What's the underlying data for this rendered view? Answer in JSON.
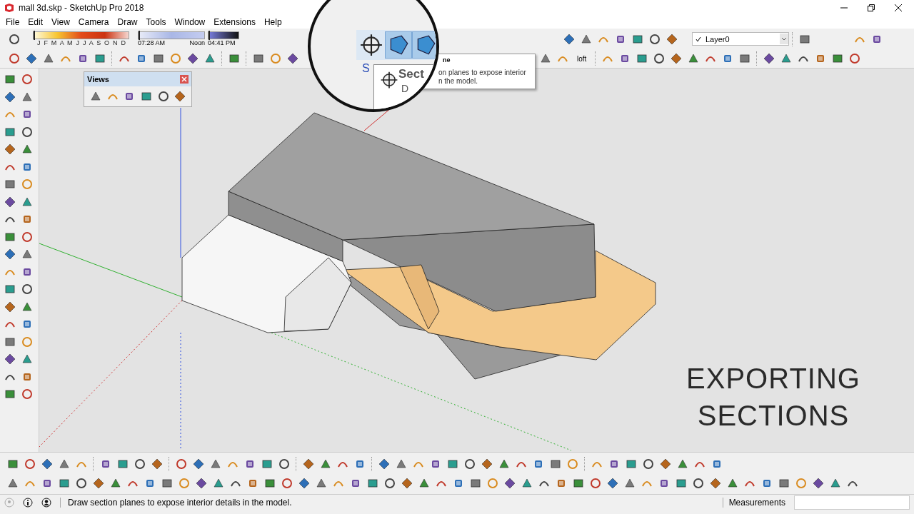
{
  "window": {
    "title": "mall 3d.skp - SketchUp Pro 2018"
  },
  "menu": [
    "File",
    "Edit",
    "View",
    "Camera",
    "Draw",
    "Tools",
    "Window",
    "Extensions",
    "Help"
  ],
  "shadow_settings": {
    "months": "J F M A M J J A S O N D",
    "month_slider": {
      "level": 0.0
    },
    "time": "07:28 AM",
    "time_slider": {
      "level": 0.0
    },
    "noon": "Noon",
    "end_time": "04:41 PM",
    "end_slider": {
      "level": 0.0
    }
  },
  "section_tools": [
    {
      "selected": false
    },
    {
      "selected": true
    },
    {
      "selected": true
    }
  ],
  "layer": {
    "value": "Layer0"
  },
  "loft_label": "loft",
  "magnifier": {
    "toolbar_letter": "S",
    "tooltip_title": "Sect",
    "tooltip_next": "D"
  },
  "tooltip": {
    "title": "ne",
    "lines": [
      "on planes to expose interior",
      "n the model."
    ]
  },
  "views_panel": {
    "title": "Views"
  },
  "overlay_caption": "EXPORTING SECTIONS",
  "status_bar": {
    "text": "Draw section planes to expose interior details in the model.",
    "measurements": "Measurements"
  }
}
